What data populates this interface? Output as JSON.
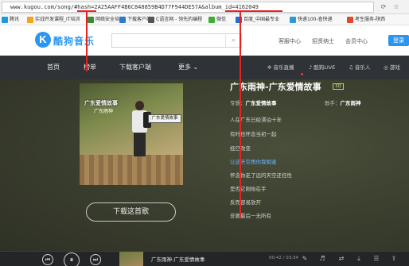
{
  "browser": {
    "url_prefix": "www.kugou.com/song/",
    "url_hash": "#hash",
    "url_rest": "=2A25AAFF4B6C848859B4D77F944DE57A&album_id=4162049"
  },
  "bookmarks": [
    {
      "label": "腾讯"
    },
    {
      "label": "实战开发课程_IT培训"
    },
    {
      "label": "网络安全培训"
    },
    {
      "label": "下载客户端"
    },
    {
      "label": "C语言网 - 领先的编程"
    },
    {
      "label": "微信"
    },
    {
      "label": "百度_中国最专业"
    },
    {
      "label": "快递100-查快递"
    },
    {
      "label": "考生服务-陕西"
    }
  ],
  "header": {
    "logo_mark": "K",
    "logo_text": "酷狗音乐",
    "search_placeholder": "",
    "links": [
      "客服中心",
      "招贤纳士",
      "会员中心"
    ],
    "login_label": "登录"
  },
  "nav": {
    "items": [
      "首页",
      "榜单",
      "下载客户端",
      "更多"
    ],
    "more_arrow": "⌄",
    "sub_items": [
      "音乐直播",
      "酷狗LIVE",
      "音乐人",
      "游戏"
    ]
  },
  "song": {
    "title": "广东雨神-广东爱情故事",
    "badge": "SQ",
    "album_label": "专辑：",
    "album": "广东爱情故事",
    "singer_label": "歌手：",
    "singer": "广东雨神",
    "cover_title": "广东爱情故事",
    "cover_name": "广东雨神",
    "cover_stamp": "广东爱情故事",
    "lyrics": [
      "人在广东已经漂泊十年",
      "有时也怀念当初一起",
      "经已改变",
      "让这天空再你我相逢",
      "怀念你走了远的天空还任性",
      "是否它刚始在手",
      "反而容易放开",
      "非要最后一无所有"
    ],
    "active_lyric_index": 3,
    "download_label": "下载这首歌"
  },
  "player": {
    "song": "广东雨神-广东爱情故事",
    "time": "00:42 / 03:34"
  }
}
